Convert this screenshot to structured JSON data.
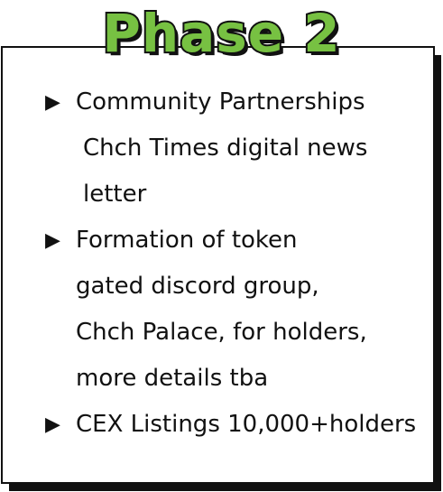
{
  "title": "Phase 2",
  "colors": {
    "title_fill": "#77c142",
    "outline": "#111111",
    "card_background": "#ffffff"
  },
  "bullet_icon": "triangle-right-icon",
  "bullet_glyph": "▶",
  "items": [
    {
      "lines": [
        "Community Partnerships",
        "Chch Times digital news",
        "letter"
      ]
    },
    {
      "lines": [
        "Formation of token",
        "gated discord group,",
        "Chch Palace, for holders,",
        "more details tba"
      ]
    },
    {
      "lines": [
        "CEX Listings 10,000+holders"
      ]
    }
  ]
}
